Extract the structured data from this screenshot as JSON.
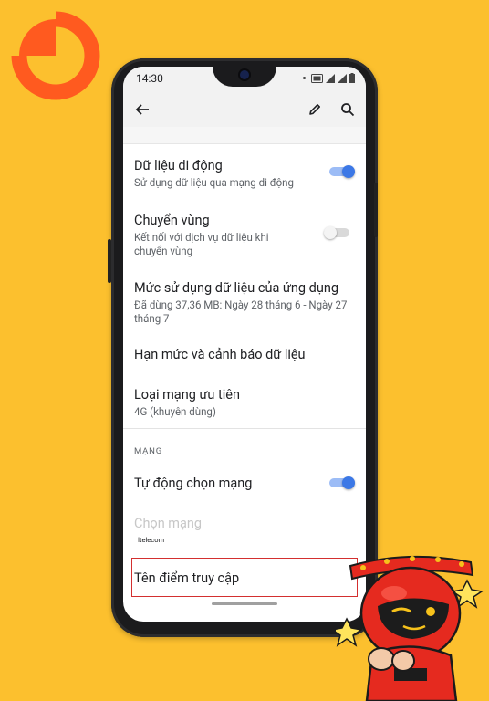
{
  "status_bar": {
    "time": "14:30"
  },
  "app_bar": {
    "back_icon": "arrow-back-icon",
    "edit_icon": "pencil-icon",
    "search_icon": "search-icon"
  },
  "settings": {
    "mobile_data": {
      "title": "Dữ liệu di động",
      "subtitle": "Sử dụng dữ liệu qua mạng di động",
      "enabled": true
    },
    "roaming": {
      "title": "Chuyển vùng",
      "subtitle": "Kết nối với dịch vụ dữ liệu khi chuyển vùng",
      "enabled": false
    },
    "app_data_usage": {
      "title": "Mức sử dụng dữ liệu của ứng dụng",
      "subtitle": "Đã dùng 37,36 MB: Ngày 28 tháng 6 - Ngày 27 tháng 7"
    },
    "data_limit": {
      "title": "Hạn mức và cảnh báo dữ liệu"
    },
    "preferred_network": {
      "title": "Loại mạng ưu tiên",
      "subtitle": "4G (khuyên dùng)"
    }
  },
  "network_section": {
    "header": "MẠNG",
    "auto_select": {
      "title": "Tự động chọn mạng",
      "enabled": true
    },
    "choose_network": {
      "title": "Chọn mạng",
      "subtitle": "Itelecom"
    },
    "access_point_names": {
      "title": "Tên điểm truy cập"
    }
  },
  "colors": {
    "background": "#fcc02e",
    "toggle_on": "#3c78e6",
    "highlight": "#d32f2f",
    "logo": "#ff5a1f"
  }
}
